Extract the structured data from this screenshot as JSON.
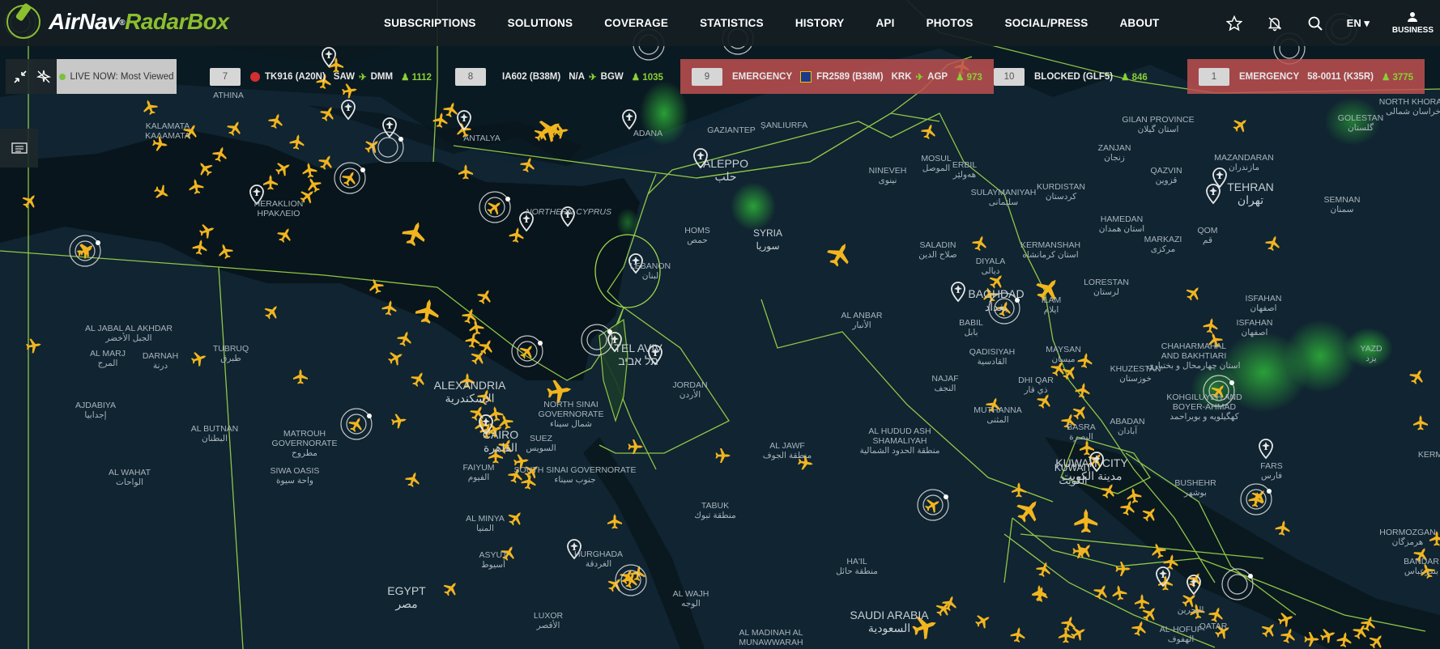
{
  "brand": {
    "name_left": "AirNav",
    "name_right": "RadarBox",
    "reg": "®"
  },
  "nav": [
    "SUBSCRIPTIONS",
    "SOLUTIONS",
    "COVERAGE",
    "STATISTICS",
    "HISTORY",
    "API",
    "PHOTOS",
    "SOCIAL/PRESS",
    "ABOUT"
  ],
  "header_right": {
    "lang": "EN ▾",
    "business": "BUSINESS"
  },
  "live": {
    "label": "LIVE NOW: Most Viewed"
  },
  "ticker": [
    {
      "rank": "7",
      "status": "",
      "flight": "TK916 (A20N)",
      "from": "SAW",
      "to": "DMM",
      "count": "1112"
    },
    {
      "rank": "8",
      "status": "",
      "flight": "IA602 (B38M)",
      "from": "N/A",
      "to": "BGW",
      "count": "1035"
    },
    {
      "rank": "9",
      "status": "EMERGENCY",
      "flight": "FR2589 (B38M)",
      "from": "KRK",
      "to": "AGP",
      "count": "973"
    },
    {
      "rank": "10",
      "status": "BLOCKED (GLF5)",
      "flight": "",
      "from": "",
      "to": "",
      "count": "846"
    },
    {
      "rank": "1",
      "status": "EMERGENCY",
      "flight": "58-0011 (K35R)",
      "from": "",
      "to": "",
      "count": "3775"
    }
  ],
  "labels": {
    "athina": "ATHINA",
    "kalamata": "KALAMATA\nΚΑΛΑΜΑΤΑ",
    "heraklion": "HERAKLION\nΗΡΑΚΛΕΙΟ",
    "antalya": "ANTALYA",
    "adana": "ADANA",
    "gaziantep": "GAZIANTEP",
    "sanliurfa": "ŞANLIURFA",
    "aleppo": "ALEPPO\nحلب",
    "nineveh": "NINEVEH\nنينوى",
    "mosul": "MOSUL\nالموصل",
    "erbil": "ERBIL\nهەولێر",
    "sulaymaniyah": "SULAYMANIYAH\nسلێمانی",
    "kurdistan": "KURDISTAN\nکردستان",
    "zanjan": "ZANJAN\nزنجان",
    "qazvin": "QAZVIN\nقزوین",
    "gilan": "GILAN PROVINCE\nاستان گیلان",
    "mazandaran": "MAZANDARAN\nمازندران",
    "golestan": "GOLESTAN\nگلستان",
    "northkhorasan": "NORTH KHORAS\nخراسان شمالی",
    "tehran": "TEHRAN\nتهران",
    "semnan": "SEMNAN\nسمنان",
    "northcyprus": "NORTHERN CYPRUS",
    "homs": "HOMS\nحمص",
    "syria": "SYRIA\nسوريا",
    "lebanon": "LEBANON\nلبنان",
    "saladin": "SALADIN\nصلاح الدين",
    "diyala": "DIYALA\nديالى",
    "baghdad": "BAGHDAD\nبغداد",
    "babil": "BABIL\nبابل",
    "kermanshah": "KERMANSHAH\nاستان کرمانشاه",
    "hamedan": "HAMEDAN\nاستان همدان",
    "markazi": "MARKAZI\nمركزى",
    "qom": "QOM\nقم",
    "lorestan": "LORESTAN\nلرستان",
    "isfahan1": "ISFAHAN\nاصفهان",
    "isfahan2": "ISFAHAN\nاصفهان",
    "ilam": "ILAM\nایلام",
    "alanbar": "AL ANBAR\nالأنبار",
    "qadisiyah": "QADISIYAH\nالقادسية",
    "maysan": "MAYSAN\nميسان",
    "chaharmahal": "CHAHARMAHAL\nAND BAKHTIARI\nاستان چهارمحال و بختیاری",
    "yazd": "YAZD\nیزد",
    "khuzestan": "KHUZESTAN\nخوزستان",
    "kohgiluyeh": "KOHGILUYEH AND\nBOYER-AHMAD\nکهگیلویه و بویراحمد",
    "najaf": "NAJAF\nالنجف",
    "dhiqar": "DHI QAR\nذي قار",
    "muthanna": "MUTHANNA\nالمثنى",
    "basra": "BASRA\nالبصرة",
    "abadan": "ABADAN\nآبادان",
    "telaviv": "TEL AVIV\nתל אביב",
    "jordan": "JORDAN\nالأردن",
    "aljabal": "AL JABAL AL AKHDAR\nالجبل الأخضر",
    "almarj": "AL MARJ\nالمرج",
    "darnah": "DARNAH\nدرنة",
    "tubruq": "TUBRUQ\nطبرق",
    "alexandria": "ALEXANDRIA\nالإسكندرية",
    "northsinai": "NORTH SINAI\nGOVERNORATE\nشمال سيناء",
    "cairo": "CAIRO\nالقاهرة",
    "suez": "SUEZ\nالسويس",
    "faiyum": "FAIYUM\nالفيوم",
    "southsinai": "SOUTH SINAI GOVERNORATE\nجنوب سيناء",
    "ajdabiya": "AJDABIYA\nإجدابيا",
    "albutnan": "AL BUTNAN\nالبطنان",
    "matrouh": "MATROUH\nGOVERNORATE\nمطروح",
    "siwa": "SIWA OASIS\nواحة سيوة",
    "alwahat": "AL WAHAT\nالواحات",
    "aljawf": "AL JAWF\nمنطقة الجوف",
    "hududash": "AL HUDUD ASH\nSHAMALIYAH\nمنطقة الحدود الشمالية",
    "kuwaitcity": "KUWAIT CITY\nمدينة الكويت",
    "kuwait": "KUWAIT\nالكويت",
    "bushehr": "BUSHEHR\nبوشهر",
    "fars": "FARS\nفارس",
    "alminya": "AL MINYA\nالمنيا",
    "asyut": "ASYUT\nأسيوط",
    "hurghada": "HURGHADA\nالغردقة",
    "tabuk": "TABUK\nمنطقة تبوك",
    "haail": "HA'IL\nمنطقة حائل",
    "egypt": "EGYPT\nمصر",
    "luxor": "LUXOR\nالأقصر",
    "alwajh": "AL WAJH\nالوجه",
    "saudiarabia": "SAUDI ARABIA\nالسعودية",
    "almadinah": "AL MADINAH AL\nMUNAWWARAH",
    "alhofuf": "AL-HOFUF\nالهفوف",
    "qatar": "QATAR",
    "bahrain": "البحرين",
    "hormozgan": "HORMOZGAN\nهرمزگان",
    "bandar": "BANDAR\nبندرعباس",
    "kerman": "KERM"
  }
}
